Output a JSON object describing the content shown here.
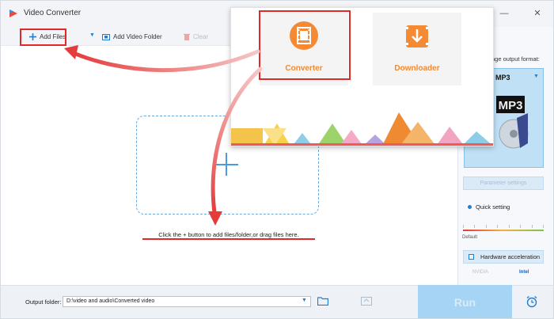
{
  "window": {
    "title": "Video Converter",
    "minimize_glyph": "—",
    "close_glyph": "✕"
  },
  "toolbar": {
    "add_files": "Add Files",
    "add_video_folder": "Add Video Folder",
    "clear": "Clear"
  },
  "main": {
    "drop_hint": "Click the + button to add files/folder,or drag files here."
  },
  "popup": {
    "converter_label": "Converter",
    "downloader_label": "Downloader"
  },
  "right_panel": {
    "output_format_label": "nge output format:",
    "format_name": "MP3",
    "format_art_text": "MP3",
    "parameter_settings": "Parameter settings",
    "quick_setting": "Quick setting",
    "default_label": "Default",
    "hardware_acceleration": "Hardware acceleration",
    "nvidia": "NVIDIA",
    "intel": "Intel"
  },
  "bottom": {
    "output_folder_label": "Output folder:",
    "output_folder_value": "D:\\video and audio\\Converted video",
    "run": "Run"
  },
  "colors": {
    "accent": "#e02a2a",
    "brand_orange": "#f08a32",
    "run_button": "#a6d4f5",
    "dashed_border": "#6aa9dd"
  }
}
